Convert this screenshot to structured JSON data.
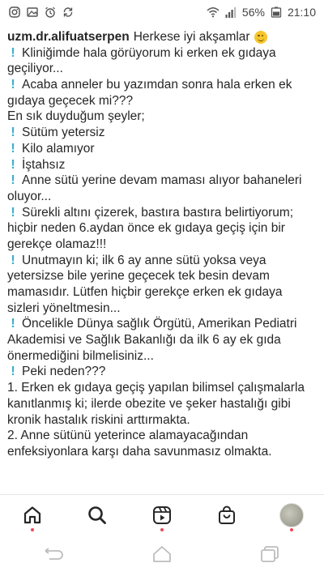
{
  "status_bar": {
    "battery_text": "56%",
    "time": "21:10",
    "left_icons": [
      "instagram-icon",
      "image-icon",
      "alarm-icon",
      "sync-icon"
    ],
    "right_icons": [
      "wifi-icon",
      "signal-icon",
      "battery-icon"
    ]
  },
  "post": {
    "username": "uzm.dr.alifuatserpen",
    "lines": [
      {
        "excl": false,
        "text": "Herkese iyi akşamlar",
        "first": true
      },
      {
        "excl": true,
        "text": "Kliniğimde hala görüyorum ki erken ek gıdaya"
      },
      {
        "excl": false,
        "text": "geçiliyor..."
      },
      {
        "excl": true,
        "text": "Acaba anneler bu yazımdan sonra hala erken ek"
      },
      {
        "excl": false,
        "text": "gıdaya geçecek mi???"
      },
      {
        "excl": false,
        "text": "En sık duyduğum şeyler;"
      },
      {
        "excl": true,
        "text": "Sütüm yetersiz"
      },
      {
        "excl": true,
        "text": "Kilo alamıyor"
      },
      {
        "excl": true,
        "text": "İştahsız"
      },
      {
        "excl": true,
        "text": "Anne sütü yerine devam maması alıyor bahaneleri"
      },
      {
        "excl": false,
        "text": "oluyor..."
      },
      {
        "excl": true,
        "text": "Sürekli altını çizerek, bastıra bastıra belirtiyorum;"
      },
      {
        "excl": false,
        "text": "hiçbir neden 6.aydan önce ek gıdaya geçiş için bir"
      },
      {
        "excl": false,
        "text": "gerekçe olamaz!!!"
      },
      {
        "excl": true,
        "text": "Unutmayın ki; ilk 6 ay anne sütü yoksa veya"
      },
      {
        "excl": false,
        "text": "yetersizse bile yerine geçecek tek besin devam"
      },
      {
        "excl": false,
        "text": "mamasıdır. Lütfen hiçbir gerekçe erken ek gıdaya"
      },
      {
        "excl": false,
        "text": "sizleri yöneltmesin..."
      },
      {
        "excl": true,
        "text": "Öncelikle Dünya sağlık Örgütü, Amerikan Pediatri"
      },
      {
        "excl": false,
        "text": "Akademisi ve Sağlık Bakanlığı da ilk 6 ay ek gıda"
      },
      {
        "excl": false,
        "text": "önermediğini bilmelisiniz..."
      },
      {
        "excl": true,
        "text": "Peki neden???"
      },
      {
        "excl": false,
        "text": "1. Erken ek gıdaya geçiş yapılan bilimsel çalışmalarla"
      },
      {
        "excl": false,
        "text": "kanıtlanmış ki; ilerde obezite ve şeker hastalığı gibi"
      },
      {
        "excl": false,
        "text": "kronik hastalık riskini arttırmakta."
      },
      {
        "excl": false,
        "text": "2. Anne sütünü yeterince alamayacağından"
      },
      {
        "excl": false,
        "text": "enfeksiyonlara karşı daha savunmasız olmakta."
      }
    ],
    "emoji": "smiley-icon",
    "excl_color": "#3ab0c9"
  },
  "bottom_nav": {
    "items": [
      "home-icon",
      "search-icon",
      "reels-icon",
      "shop-icon",
      "profile-avatar"
    ],
    "notification_color": "#ed4956"
  },
  "system_nav": {
    "items": [
      "back-icon",
      "home-button-icon",
      "recents-icon"
    ]
  }
}
